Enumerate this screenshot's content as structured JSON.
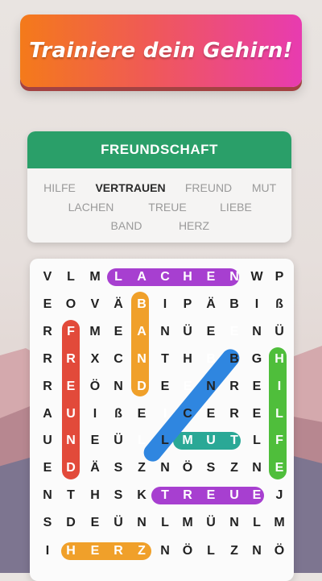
{
  "banner": {
    "text": "Trainiere dein Gehirn!"
  },
  "category": "FREUNDSCHAFT",
  "words": [
    {
      "text": "HILFE",
      "found": true
    },
    {
      "text": "VERTRAUEN",
      "found": false
    },
    {
      "text": "FREUND",
      "found": true
    },
    {
      "text": "MUT",
      "found": true
    },
    {
      "text": "LACHEN",
      "found": true
    },
    {
      "text": "TREUE",
      "found": true
    },
    {
      "text": "LIEBE",
      "found": true
    },
    {
      "text": "BAND",
      "found": true
    },
    {
      "text": "HERZ",
      "found": true
    }
  ],
  "grid": [
    [
      "V",
      "L",
      "M",
      "L",
      "A",
      "C",
      "H",
      "E",
      "N",
      "W",
      "P"
    ],
    [
      "E",
      "O",
      "V",
      "Ä",
      "B",
      "I",
      "P",
      "Ä",
      "B",
      "I",
      "ß"
    ],
    [
      "R",
      "F",
      "M",
      "E",
      "A",
      "N",
      "Ü",
      "E",
      "E",
      "N",
      "Ü"
    ],
    [
      "R",
      "R",
      "X",
      "C",
      "N",
      "T",
      "H",
      "B",
      "B",
      "G",
      "H"
    ],
    [
      "R",
      "E",
      "Ö",
      "N",
      "D",
      "E",
      "E",
      "N",
      "R",
      "E",
      "I"
    ],
    [
      "A",
      "U",
      "I",
      "ß",
      "E",
      "I",
      "C",
      "E",
      "R",
      "E",
      "L"
    ],
    [
      "U",
      "N",
      "E",
      "Ü",
      "L",
      "L",
      "M",
      "U",
      "T",
      "L",
      "F"
    ],
    [
      "E",
      "D",
      "Ä",
      "S",
      "Z",
      "N",
      "Ö",
      "S",
      "Z",
      "N",
      "E"
    ],
    [
      "N",
      "T",
      "H",
      "S",
      "K",
      "T",
      "R",
      "E",
      "U",
      "E",
      "J"
    ],
    [
      "S",
      "D",
      "E",
      "Ü",
      "N",
      "L",
      "M",
      "Ü",
      "N",
      "L",
      "M"
    ],
    [
      "I",
      "H",
      "E",
      "R",
      "Z",
      "N",
      "Ö",
      "L",
      "Z",
      "N",
      "Ö"
    ]
  ],
  "highlight_colors": {
    "LACHEN": "#a73fd0",
    "BAND": "#f0a02a",
    "FREUND": "#e24a3a",
    "LIEBE": "#2f86e0",
    "HILFE": "#4fbe3b",
    "MUT": "#2aa896",
    "TREUE": "#a73fd0",
    "HERZ": "#f0a02a"
  }
}
